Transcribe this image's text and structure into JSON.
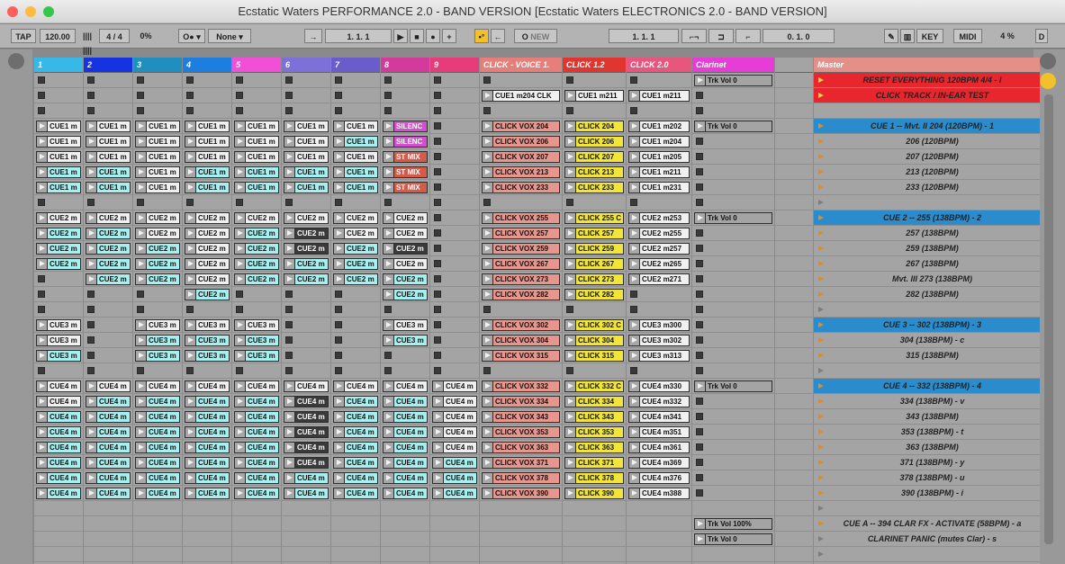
{
  "window": {
    "title": "Ecstatic Waters PERFORMANCE 2.0 - BAND VERSION  [Ecstatic Waters ELECTRONICS 2.0 - BAND VERSION]"
  },
  "toolbar": {
    "tap": "TAP",
    "tempo": "120.00",
    "meter": "4 / 4",
    "groove": "0%",
    "quant": "None",
    "pos1": "1.   1.   1",
    "pos2": "1.   1.   1",
    "pos3": "0.   1.   0",
    "new": "NEW",
    "key": "KEY",
    "midi": "MIDI",
    "cpu": "4 %",
    "d": "D"
  },
  "tracks": [
    {
      "name": "1",
      "color": "#36b8e8"
    },
    {
      "name": "2",
      "color": "#1533e0"
    },
    {
      "name": "3",
      "color": "#1f8fc0"
    },
    {
      "name": "4",
      "color": "#1b7ee0"
    },
    {
      "name": "5",
      "color": "#f14fd8"
    },
    {
      "name": "6",
      "color": "#7d70d8"
    },
    {
      "name": "7",
      "color": "#6b5ccc"
    },
    {
      "name": "8",
      "color": "#d43a9c"
    },
    {
      "name": "9",
      "color": "#e83c7a"
    },
    {
      "name": "CLICK - VOICE 1.",
      "color": "#e87e79"
    },
    {
      "name": "CLICK 1.2",
      "color": "#e0362f"
    },
    {
      "name": "CLICK 2.0",
      "color": "#e8567e"
    },
    {
      "name": "Clarinet",
      "color": "#e83cd8"
    },
    {
      "name": "",
      "color": "#a4a4a4"
    },
    {
      "name": "Master",
      "color": "#e49088"
    }
  ],
  "clip_colors": {
    "w": "#f0f0f0",
    "g": "#a4a4a4",
    "c": "#a8f0f0",
    "dk": "#3a3a3a",
    "m": "#d44fcf",
    "r": "#d45a4a",
    "s": "#e6968c",
    "y": "#f2e53a"
  },
  "rows": [
    {
      "cells": [
        "x",
        "x",
        "x",
        "x",
        "x",
        "x",
        "x",
        "x",
        "x",
        "x",
        "x",
        "x",
        "g:Trk Vol 0"
      ],
      "scene": "RESET EVERYTHING 120BPM 4/4 - l",
      "sc": "#e8262e",
      "ri": 1
    },
    {
      "cells": [
        "x",
        "x",
        "x",
        "x",
        "x",
        "x",
        "x",
        "x",
        "x",
        "w:CUE1 m204 CLK",
        "w:CUE1 m211",
        "w:CUE1 m211",
        "x"
      ],
      "scene": "CLICK TRACK / IN-EAR TEST",
      "sc": "#e8262e",
      "ri": 1
    },
    {
      "cells": [
        "x",
        "x",
        "x",
        "x",
        "x",
        "x",
        "x",
        "x",
        "x",
        "x",
        "x",
        "x",
        "x"
      ],
      "scene": "",
      "sc": "",
      "ri": 0
    },
    {
      "cells": [
        "w:CUE1 m",
        "w:CUE1 m",
        "w:CUE1 m",
        "w:CUE1 m",
        "w:CUE1 m",
        "w:CUE1 m",
        "w:CUE1 m",
        "m:SILENC",
        "x",
        "s:CLICK VOX 204",
        "y:CLICK 204",
        "w:CUE1 m202",
        "g:Trk Vol 0"
      ],
      "scene": "CUE 1 -- Mvt. II 204 (120BPM) - 1",
      "sc": "#2a8ccc",
      "ri": 1
    },
    {
      "cells": [
        "w:CUE1 m",
        "w:CUE1 m",
        "w:CUE1 m",
        "w:CUE1 m",
        "w:CUE1 m",
        "w:CUE1 m",
        "c:CUE1 m",
        "m:SILENC",
        "x",
        "s:CLICK VOX 206",
        "y:CLICK 206",
        "w:CUE1 m204",
        "x"
      ],
      "scene": "206 (120BPM)",
      "sc": "",
      "ri": 1
    },
    {
      "cells": [
        "w:CUE1 m",
        "w:CUE1 m",
        "w:CUE1 m",
        "w:CUE1 m",
        "w:CUE1 m",
        "w:CUE1 m",
        "w:CUE1 m",
        "r:ST MIX",
        "x",
        "s:CLICK VOX 207",
        "y:CLICK 207",
        "w:CUE1 m205",
        "x"
      ],
      "scene": "207 (120BPM)",
      "sc": "",
      "ri": 1
    },
    {
      "cells": [
        "c:CUE1 m",
        "c:CUE1 m",
        "w:CUE1 m",
        "c:CUE1 m",
        "c:CUE1 m",
        "c:CUE1 m",
        "c:CUE1 m",
        "r:ST MIX",
        "x",
        "s:CLICK VOX 213",
        "y:CLICK 213",
        "w:CUE1 m211",
        "x"
      ],
      "scene": "213 (120BPM)",
      "sc": "",
      "ri": 1
    },
    {
      "cells": [
        "c:CUE1 m",
        "c:CUE1 m",
        "w:CUE1 m",
        "c:CUE1 m",
        "c:CUE1 m",
        "c:CUE1 m",
        "c:CUE1 m",
        "r:ST MIX",
        "x",
        "s:CLICK VOX 233",
        "y:CLICK 233",
        "w:CUE1 m231",
        "x"
      ],
      "scene": "233 (120BPM)",
      "sc": "",
      "ri": 1
    },
    {
      "cells": [
        "x",
        "x",
        "x",
        "x",
        "x",
        "x",
        "x",
        "x",
        "x",
        "x",
        "x",
        "x",
        "x"
      ],
      "scene": "",
      "sc": "",
      "ri": 2
    },
    {
      "cells": [
        "w:CUE2 m",
        "w:CUE2 m",
        "w:CUE2 m",
        "w:CUE2 m",
        "w:CUE2 m",
        "w:CUE2 m",
        "w:CUE2 m",
        "w:CUE2 m",
        "x",
        "s:CLICK VOX 255",
        "y:CLICK 255 C",
        "w:CUE2 m253",
        "g:Trk Vol 0"
      ],
      "scene": "CUE 2 -- 255 (138BPM) - 2",
      "sc": "#2a8ccc",
      "ri": 1
    },
    {
      "cells": [
        "c:CUE2 m",
        "c:CUE2 m",
        "w:CUE2 m",
        "w:CUE2 m",
        "c:CUE2 m",
        "dk:CUE2 m",
        "w:CUE2 m",
        "w:CUE2 m",
        "x",
        "s:CLICK VOX 257",
        "y:CLICK 257",
        "w:CUE2 m255",
        "x"
      ],
      "scene": "257 (138BPM)",
      "sc": "",
      "ri": 1
    },
    {
      "cells": [
        "c:CUE2 m",
        "c:CUE2 m",
        "c:CUE2 m",
        "w:CUE2 m",
        "c:CUE2 m",
        "dk:CUE2 m",
        "c:CUE2 m",
        "dk:CUE2 m",
        "x",
        "s:CLICK VOX 259",
        "y:CLICK 259",
        "w:CUE2 m257",
        "x"
      ],
      "scene": "259 (138BPM)",
      "sc": "",
      "ri": 1
    },
    {
      "cells": [
        "c:CUE2 m",
        "c:CUE2 m",
        "c:CUE2 m",
        "w:CUE2 m",
        "c:CUE2 m",
        "c:CUE2 m",
        "c:CUE2 m",
        "w:CUE2 m",
        "x",
        "s:CLICK VOX 267",
        "y:CLICK 267",
        "w:CUE2 m265",
        "x"
      ],
      "scene": "267 (138BPM)",
      "sc": "",
      "ri": 1
    },
    {
      "cells": [
        "x",
        "c:CUE2 m",
        "c:CUE2 m",
        "w:CUE2 m",
        "c:CUE2 m",
        "c:CUE2 m",
        "c:CUE2 m",
        "c:CUE2 m",
        "x",
        "s:CLICK VOX 273",
        "y:CLICK 273",
        "w:CUE2 m271",
        "x"
      ],
      "scene": "Mvt. III 273 (138BPM)",
      "sc": "",
      "ri": 1
    },
    {
      "cells": [
        "x",
        "x",
        "x",
        "c:CUE2 m",
        "x",
        "x",
        "x",
        "c:CUE2 m",
        "x",
        "s:CLICK VOX 282",
        "y:CLICK 282",
        "x",
        "x"
      ],
      "scene": "282 (138BPM)",
      "sc": "",
      "ri": 1
    },
    {
      "cells": [
        "x",
        "x",
        "x",
        "x",
        "x",
        "x",
        "x",
        "x",
        "x",
        "x",
        "x",
        "x",
        "x"
      ],
      "scene": "",
      "sc": "",
      "ri": 2
    },
    {
      "cells": [
        "w:CUE3 m",
        "x",
        "w:CUE3 m",
        "w:CUE3 m",
        "w:CUE3 m",
        "x",
        "x",
        "w:CUE3 m",
        "x",
        "s:CLICK VOX 302",
        "y:CLICK 302 C",
        "w:CUE3 m300",
        "x"
      ],
      "scene": "CUE 3 -- 302 (138BPM) - 3",
      "sc": "#2a8ccc",
      "ri": 1
    },
    {
      "cells": [
        "w:CUE3 m",
        "x",
        "c:CUE3 m",
        "c:CUE3 m",
        "c:CUE3 m",
        "x",
        "x",
        "c:CUE3 m",
        "x",
        "s:CLICK VOX 304",
        "y:CLICK 304",
        "w:CUE3 m302",
        "x"
      ],
      "scene": "304 (138BPM) - c",
      "sc": "",
      "ri": 1
    },
    {
      "cells": [
        "c:CUE3 m",
        "x",
        "c:CUE3 m",
        "c:CUE3 m",
        "c:CUE3 m",
        "x",
        "x",
        "x",
        "x",
        "s:CLICK VOX 315",
        "y:CLICK 315",
        "w:CUE3 m313",
        "x"
      ],
      "scene": "315 (138BPM)",
      "sc": "",
      "ri": 1
    },
    {
      "cells": [
        "x",
        "x",
        "x",
        "x",
        "x",
        "x",
        "x",
        "x",
        "x",
        "x",
        "x",
        "x",
        "x"
      ],
      "scene": "",
      "sc": "",
      "ri": 2
    },
    {
      "cells": [
        "w:CUE4 m",
        "w:CUE4 m",
        "w:CUE4 m",
        "w:CUE4 m",
        "w:CUE4 m",
        "w:CUE4 m",
        "w:CUE4 m",
        "w:CUE4 m",
        "w:CUE4 m",
        "s:CLICK VOX 332",
        "y:CLICK 332 C",
        "w:CUE4 m330",
        "g:Trk Vol 0"
      ],
      "scene": "CUE 4 -- 332 (138BPM) - 4",
      "sc": "#2a8ccc",
      "ri": 1
    },
    {
      "cells": [
        "w:CUE4 m",
        "c:CUE4 m",
        "c:CUE4 m",
        "c:CUE4 m",
        "c:CUE4 m",
        "dk:CUE4 m",
        "c:CUE4 m",
        "c:CUE4 m",
        "w:CUE4 m",
        "s:CLICK VOX 334",
        "y:CLICK 334",
        "w:CUE4 m332",
        "x"
      ],
      "scene": "334 (138BPM) - v",
      "sc": "",
      "ri": 1
    },
    {
      "cells": [
        "c:CUE4 m",
        "c:CUE4 m",
        "c:CUE4 m",
        "c:CUE4 m",
        "c:CUE4 m",
        "dk:CUE4 m",
        "c:CUE4 m",
        "c:CUE4 m",
        "w:CUE4 m",
        "s:CLICK VOX 343",
        "y:CLICK 343",
        "w:CUE4 m341",
        "x"
      ],
      "scene": "343 (138BPM)",
      "sc": "",
      "ri": 1
    },
    {
      "cells": [
        "c:CUE4 m",
        "c:CUE4 m",
        "c:CUE4 m",
        "c:CUE4 m",
        "c:CUE4 m",
        "dk:CUE4 m",
        "c:CUE4 m",
        "c:CUE4 m",
        "w:CUE4 m",
        "s:CLICK VOX 353",
        "y:CLICK 353",
        "w:CUE4 m351",
        "x"
      ],
      "scene": "353 (138BPM) - t",
      "sc": "",
      "ri": 1
    },
    {
      "cells": [
        "c:CUE4 m",
        "c:CUE4 m",
        "c:CUE4 m",
        "c:CUE4 m",
        "c:CUE4 m",
        "dk:CUE4 m",
        "c:CUE4 m",
        "c:CUE4 m",
        "w:CUE4 m",
        "s:CLICK VOX 363",
        "y:CLICK 363",
        "w:CUE4 m361",
        "x"
      ],
      "scene": "363 (138BPM)",
      "sc": "",
      "ri": 1
    },
    {
      "cells": [
        "c:CUE4 m",
        "c:CUE4 m",
        "c:CUE4 m",
        "c:CUE4 m",
        "c:CUE4 m",
        "dk:CUE4 m",
        "c:CUE4 m",
        "c:CUE4 m",
        "c:CUE4 m",
        "s:CLICK VOX 371",
        "y:CLICK 371",
        "w:CUE4 m369",
        "x"
      ],
      "scene": "371 (138BPM) - y",
      "sc": "",
      "ri": 1
    },
    {
      "cells": [
        "c:CUE4 m",
        "c:CUE4 m",
        "c:CUE4 m",
        "c:CUE4 m",
        "c:CUE4 m",
        "c:CUE4 m",
        "c:CUE4 m",
        "c:CUE4 m",
        "c:CUE4 m",
        "s:CLICK VOX 378",
        "y:CLICK 378",
        "w:CUE4 m376",
        "x"
      ],
      "scene": "378 (138BPM) - u",
      "sc": "",
      "ri": 1
    },
    {
      "cells": [
        "c:CUE4 m",
        "c:CUE4 m",
        "c:CUE4 m",
        "c:CUE4 m",
        "c:CUE4 m",
        "c:CUE4 m",
        "c:CUE4 m",
        "c:CUE4 m",
        "c:CUE4 m",
        "s:CLICK VOX 390",
        "y:CLICK 390",
        "w:CUE4 m388",
        "x"
      ],
      "scene": "390 (138BPM) - i",
      "sc": "",
      "ri": 1
    },
    {
      "cells": [
        "",
        "",
        "",
        "",
        "",
        "",
        "",
        "",
        "",
        "",
        "",
        "",
        ""
      ],
      "scene": "",
      "sc": "",
      "ri": 2
    },
    {
      "cells": [
        "",
        "",
        "",
        "",
        "",
        "",
        "",
        "",
        "",
        "",
        "",
        "",
        "g:Trk Vol 100%"
      ],
      "scene": "CUE A -- 394 CLAR FX - ACTIVATE (58BPM) - a",
      "sc": "",
      "ri": 1
    },
    {
      "cells": [
        "",
        "",
        "",
        "",
        "",
        "",
        "",
        "",
        "",
        "",
        "",
        "",
        "g:Trk Vol 0"
      ],
      "scene": "CLARINET PANIC (mutes Clar) - s",
      "sc": "",
      "ri": 2
    },
    {
      "cells": [
        "",
        "",
        "",
        "",
        "",
        "",
        "",
        "",
        "",
        "",
        "",
        "",
        ""
      ],
      "scene": "",
      "sc": "",
      "ri": 2
    }
  ]
}
